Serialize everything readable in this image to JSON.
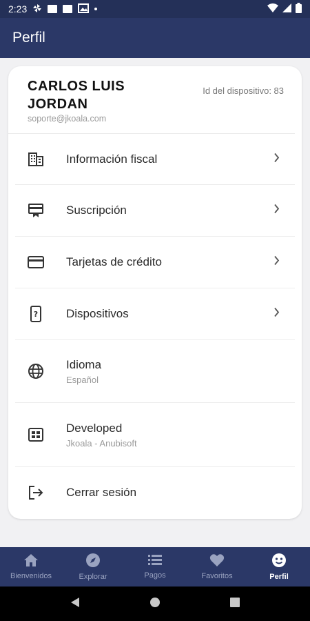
{
  "status_bar": {
    "time": "2:23"
  },
  "app_bar": {
    "title": "Perfil"
  },
  "profile": {
    "name": "CARLOS LUIS JORDAN",
    "email": "soporte@jkoala.com",
    "device_id": "Id del dispositivo: 83"
  },
  "menu": {
    "items": [
      {
        "label": "Información fiscal",
        "icon": "building-icon"
      },
      {
        "label": "Suscripción",
        "icon": "subscription-icon"
      },
      {
        "label": "Tarjetas de crédito",
        "icon": "credit-card-icon"
      },
      {
        "label": "Dispositivos",
        "icon": "phone-question-icon"
      },
      {
        "label": "Idioma",
        "sub": "Español",
        "icon": "globe-icon"
      },
      {
        "label": "Developed",
        "sub": "Jkoala - Anubisoft",
        "icon": "developer-icon"
      },
      {
        "label": "Cerrar sesión",
        "icon": "logout-icon"
      }
    ]
  },
  "bottom_nav": {
    "items": [
      {
        "label": "Bienvenidos",
        "icon": "home-icon"
      },
      {
        "label": "Explorar",
        "icon": "compass-icon"
      },
      {
        "label": "Pagos",
        "icon": "list-icon"
      },
      {
        "label": "Favoritos",
        "icon": "heart-icon"
      },
      {
        "label": "Perfil",
        "icon": "profile-face-icon"
      }
    ],
    "active": "Perfil"
  },
  "colors": {
    "primary": "#2b3867",
    "status_bar": "#243058",
    "background": "#f1f1f3",
    "inactive_nav": "#9aa3c0"
  }
}
